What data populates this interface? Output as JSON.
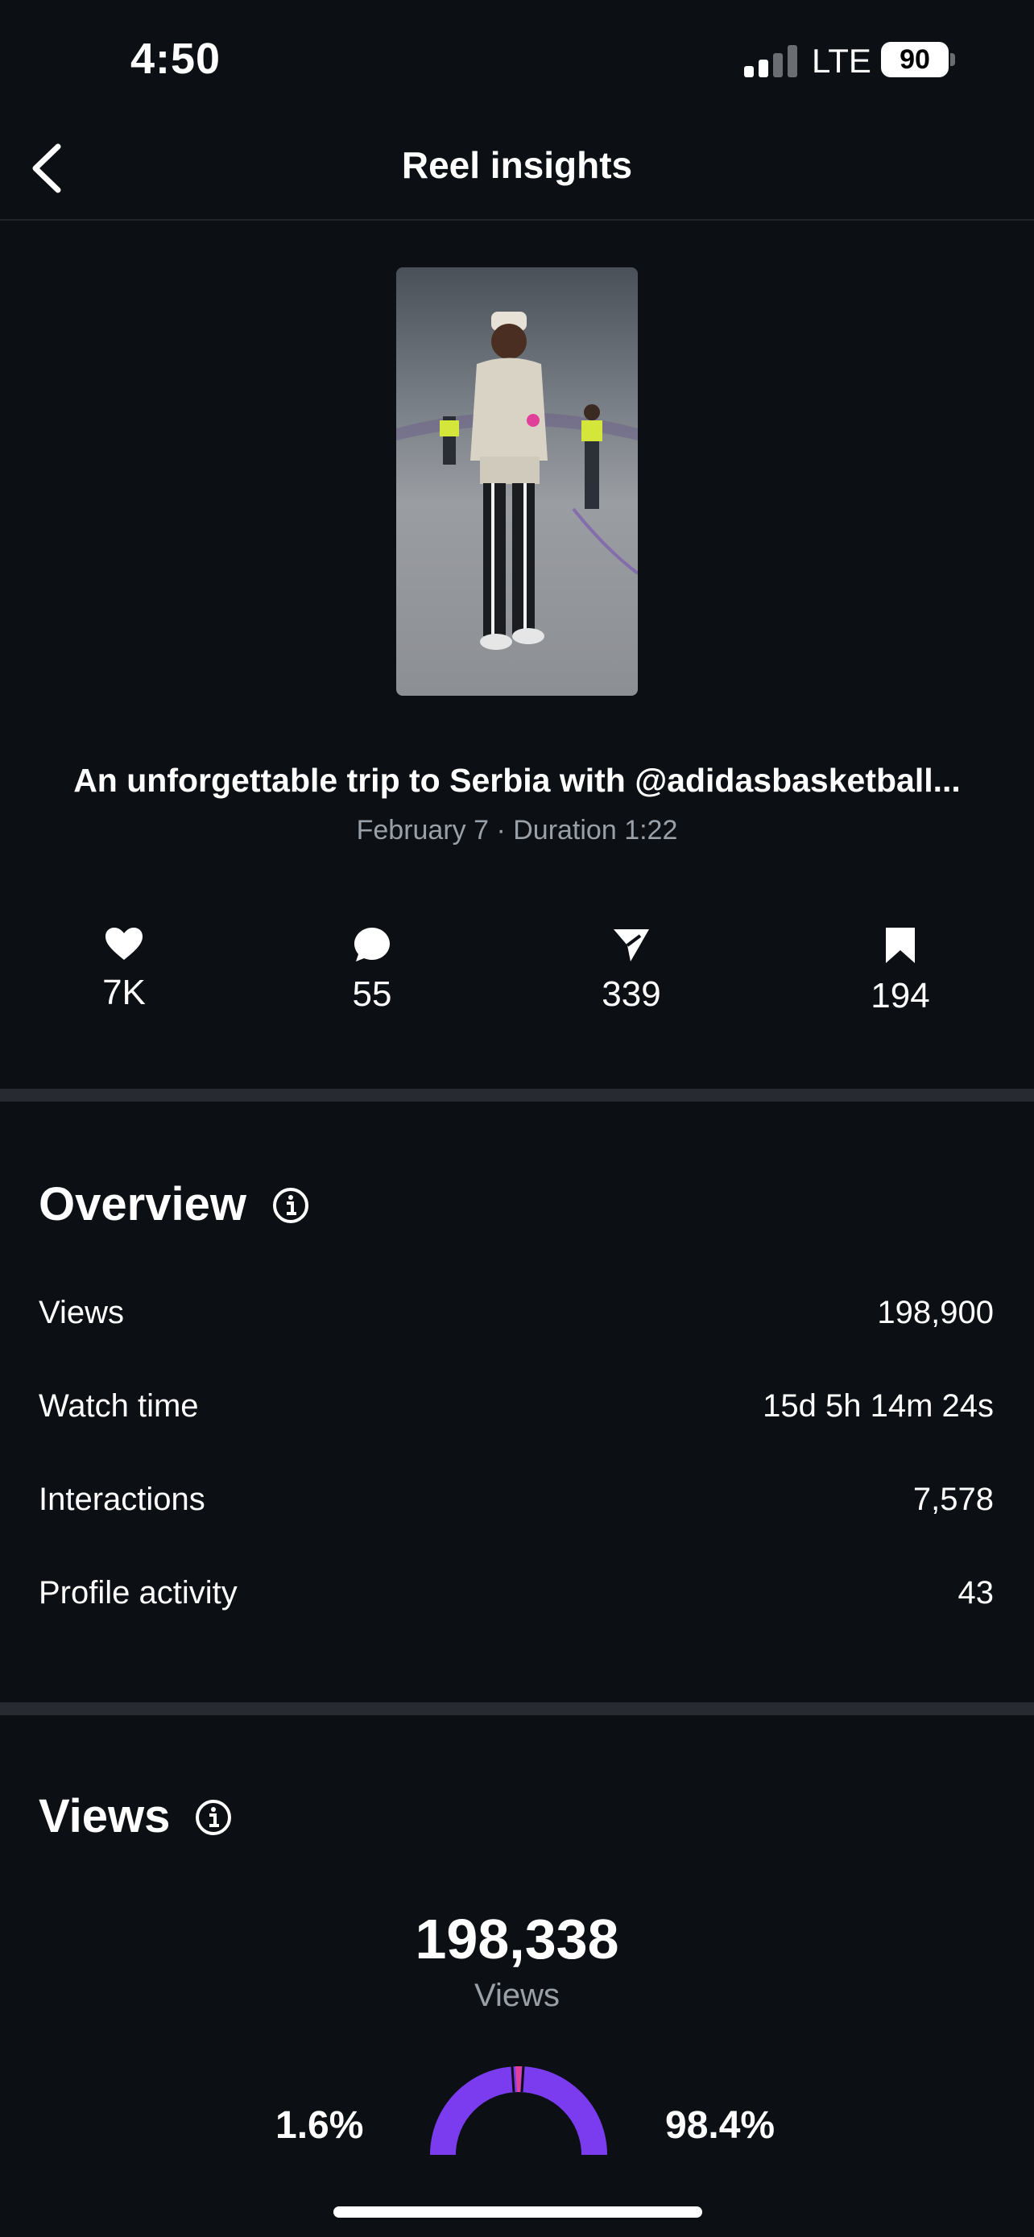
{
  "status_bar": {
    "time": "4:50",
    "network": "LTE",
    "battery": "90"
  },
  "header": {
    "title": "Reel insights",
    "back_icon": "chevron-left-icon"
  },
  "reel": {
    "caption": "An unforgettable trip to Serbia with @adidasbasketball...",
    "meta": "February 7 · Duration 1:22"
  },
  "stats": [
    {
      "icon": "heart-icon",
      "value": "7K"
    },
    {
      "icon": "comment-icon",
      "value": "55"
    },
    {
      "icon": "share-icon",
      "value": "339"
    },
    {
      "icon": "bookmark-icon",
      "value": "194"
    }
  ],
  "overview": {
    "title": "Overview",
    "rows": [
      {
        "label": "Views",
        "value": "198,900"
      },
      {
        "label": "Watch time",
        "value": "15d 5h 14m 24s"
      },
      {
        "label": "Interactions",
        "value": "7,578"
      },
      {
        "label": "Profile activity",
        "value": "43"
      }
    ]
  },
  "views": {
    "title": "Views",
    "total": "198,338",
    "total_label": "Views",
    "left_pct": "1.6%",
    "right_pct": "98.4%",
    "colors": {
      "primary": "#7b3cf0",
      "accent": "#e0409a"
    }
  }
}
